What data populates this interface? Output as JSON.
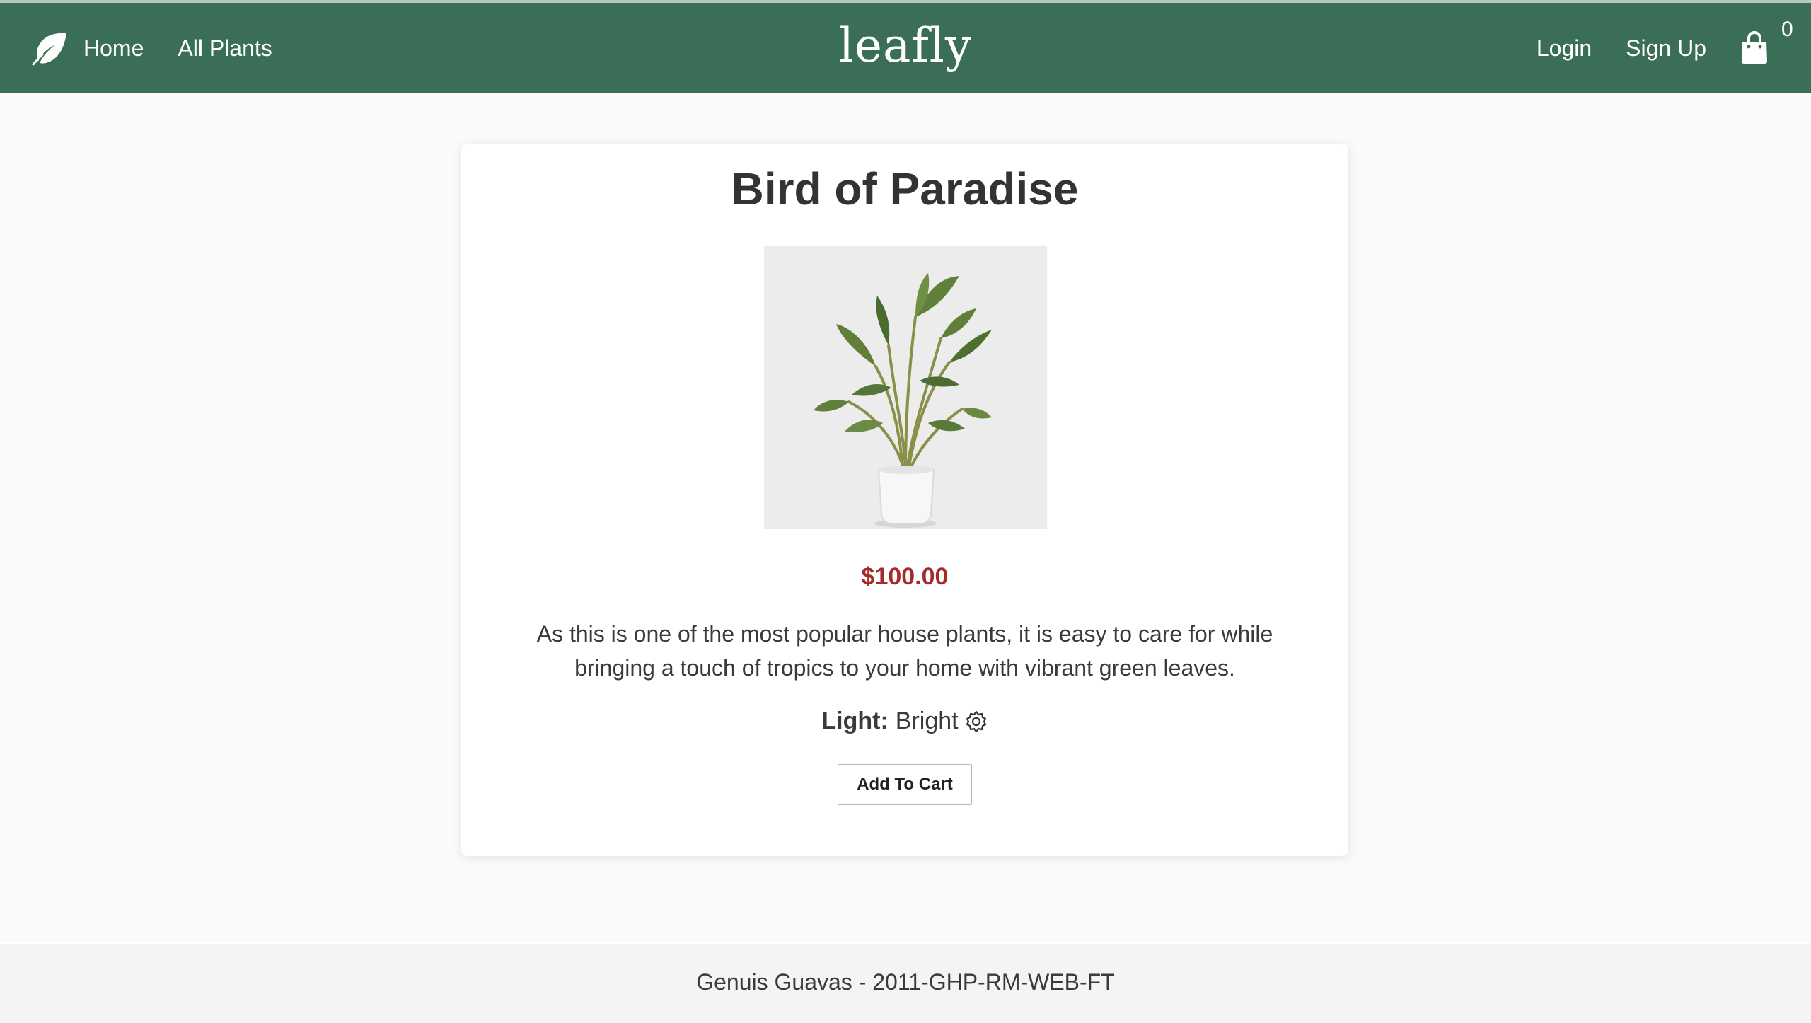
{
  "nav": {
    "home_label": "Home",
    "all_plants_label": "All Plants",
    "brand": "leafly",
    "login_label": "Login",
    "signup_label": "Sign Up",
    "cart_count": "0",
    "icons": [
      "leaf-icon",
      "shopping-bag-icon"
    ]
  },
  "product": {
    "name": "Bird of Paradise",
    "image_alt": "potted plant",
    "price": "$100.00",
    "description": "As this is one of the most popular house plants, it is easy to care for while bringing a touch of tropics to your home with vibrant green leaves.",
    "light_label": "Light:",
    "light_value": "Bright",
    "light_icon": "sun-gear-icon",
    "add_to_cart_label": "Add To Cart"
  },
  "footer": {
    "text": "Genuis Guavas - 2011-GHP-RM-WEB-FT"
  },
  "colors": {
    "navbar": "#3b6e57",
    "price": "#a52a2a",
    "background": "#fafafa"
  }
}
